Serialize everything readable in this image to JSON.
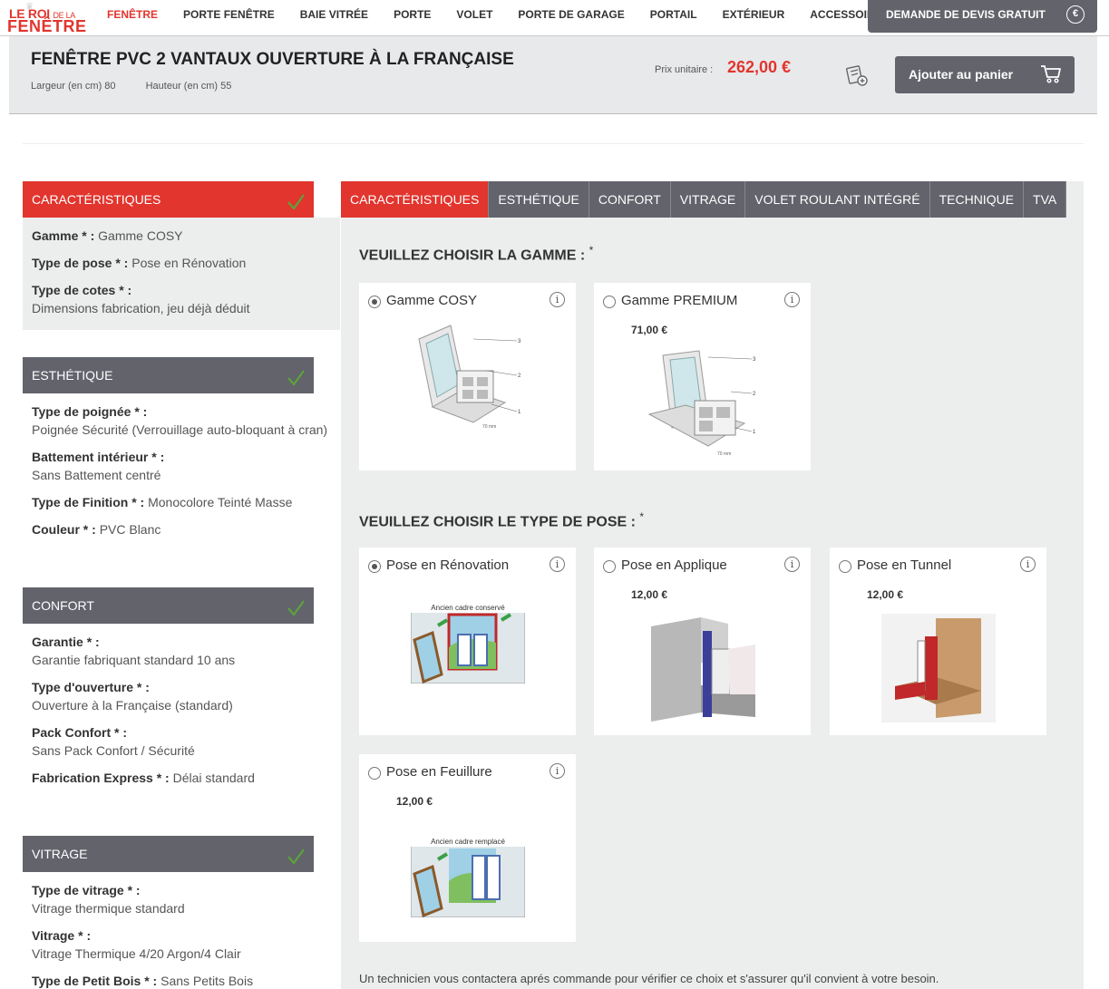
{
  "logo": {
    "line1": "LE ROI",
    "line1_small": "DE LA",
    "line2": "FENÊTRE"
  },
  "nav": {
    "items": [
      "FENÊTRE",
      "PORTE FENÊTRE",
      "BAIE VITRÉE",
      "PORTE",
      "VOLET",
      "PORTE DE GARAGE",
      "PORTAIL",
      "EXTÉRIEUR",
      "ACCESSOIRE"
    ],
    "active_index": 0,
    "devis_label": "DEMANDE DE DEVIS GRATUIT",
    "devis_icon": "€"
  },
  "product": {
    "title": "FENÊTRE PVC 2 VANTAUX OUVERTURE À LA FRANÇAISE",
    "width_label": "Largeur (en cm) 80",
    "height_label": "Hauteur (en cm) 55",
    "price_label": "Prix unitaire :",
    "price": "262,00 €",
    "cart_label": "Ajouter au panier"
  },
  "sidebar": {
    "sections": [
      {
        "title": "CARACTÉRISTIQUES",
        "done": true,
        "active": true,
        "rows": [
          {
            "label": "Gamme",
            "value": "Gamme COSY",
            "inline": true
          },
          {
            "label": "Type de pose",
            "value": "Pose en Rénovation",
            "inline": true
          },
          {
            "label": "Type de cotes",
            "value": "Dimensions fabrication, jeu déjà déduit",
            "inline": false
          }
        ]
      },
      {
        "title": "ESTHÉTIQUE",
        "done": true,
        "active": false,
        "rows": [
          {
            "label": "Type de poignée",
            "value": "Poignée Sécurité (Verrouillage auto-bloquant à cran)",
            "inline": false
          },
          {
            "label": "Battement intérieur",
            "value": "Sans Battement centré",
            "inline": false
          },
          {
            "label": "Type de Finition",
            "value": "Monocolore Teinté Masse",
            "inline": true
          },
          {
            "label": "Couleur",
            "value": "PVC Blanc",
            "inline": true
          }
        ]
      },
      {
        "title": "CONFORT",
        "done": true,
        "active": false,
        "rows": [
          {
            "label": "Garantie",
            "value": "Garantie fabriquant standard 10 ans",
            "inline": false
          },
          {
            "label": "Type d'ouverture",
            "value": "Ouverture à la Française (standard)",
            "inline": false
          },
          {
            "label": "Pack Confort",
            "value": "Sans Pack Confort / Sécurité",
            "inline": false
          },
          {
            "label": "Fabrication Express",
            "value": "Délai standard",
            "inline": true
          }
        ]
      },
      {
        "title": "VITRAGE",
        "done": true,
        "active": false,
        "rows": [
          {
            "label": "Type de vitrage",
            "value": "Vitrage thermique standard",
            "inline": false
          },
          {
            "label": "Vitrage",
            "value": "Vitrage Thermique 4/20 Argon/4 Clair",
            "inline": false
          },
          {
            "label": "Type de Petit Bois",
            "value": "Sans Petits Bois",
            "inline": true
          }
        ]
      }
    ]
  },
  "tabs": [
    "CARACTÉRISTIQUES",
    "ESTHÉTIQUE",
    "CONFORT",
    "VITRAGE",
    "VOLET ROULANT INTÉGRÉ",
    "TECHNIQUE",
    "TVA"
  ],
  "gamme": {
    "title": "VEUILLEZ CHOISIR LA GAMME :",
    "options": [
      {
        "name": "Gamme COSY",
        "price": "",
        "selected": true
      },
      {
        "name": "Gamme PREMIUM",
        "price": "71,00 €",
        "selected": false
      }
    ]
  },
  "pose": {
    "title": "VEUILLEZ CHOISIR LE TYPE DE POSE :",
    "options": [
      {
        "name": "Pose en Rénovation",
        "price": "",
        "selected": true,
        "img_caption": "Ancien cadre conservé"
      },
      {
        "name": "Pose en Applique",
        "price": "12,00 €",
        "selected": false
      },
      {
        "name": "Pose en Tunnel",
        "price": "12,00 €",
        "selected": false
      },
      {
        "name": "Pose en Feuillure",
        "price": "12,00 €",
        "selected": false,
        "img_caption": "Ancien cadre remplacé"
      }
    ]
  },
  "footer_note": "Un technicien vous contactera aprés commande pour vérifier ce choix et s'assurer qu'il convient à votre besoin.",
  "required_mark": "*",
  "colors": {
    "accent": "#e1352e",
    "dark": "#62636b",
    "panel": "#eceded"
  }
}
